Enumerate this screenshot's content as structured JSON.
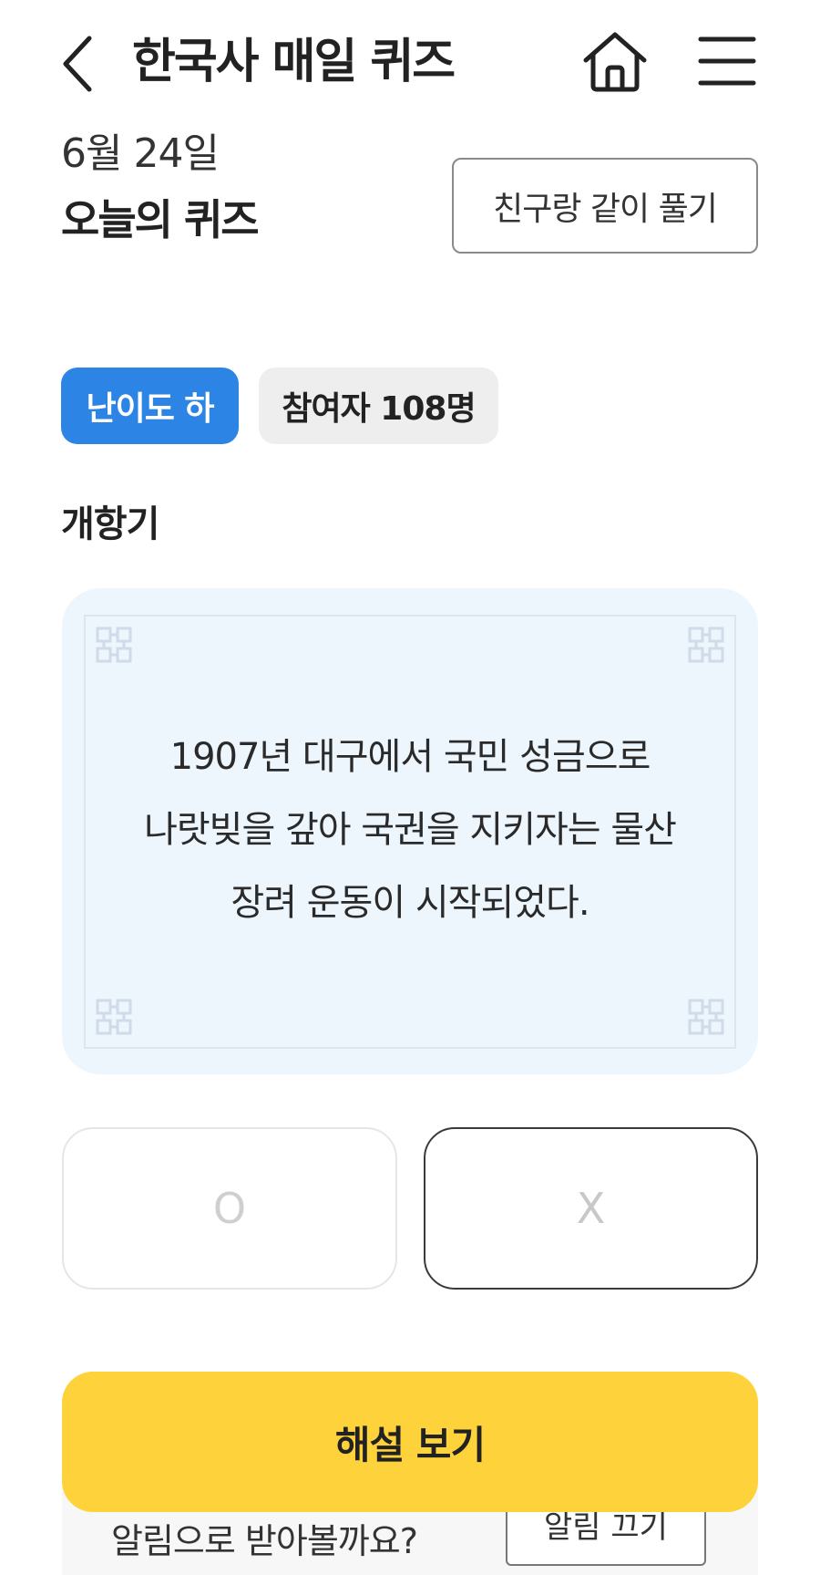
{
  "header": {
    "title": "한국사 매일 퀴즈",
    "back_icon": "chevron-left-icon",
    "home_icon": "home-icon",
    "menu_icon": "hamburger-menu-icon"
  },
  "quiz_info": {
    "date": "6월 24일",
    "heading": "오늘의 퀴즈",
    "friend_button": "친구랑 같이 풀기"
  },
  "badges": {
    "level": "난이도 하",
    "participants": "참여자 108명"
  },
  "category": "개항기",
  "question": {
    "lines": [
      "1907년 대구에서 국민 성금으로",
      "나랏빚을 갚아 국권을 지키자는 물산",
      "장려 운동이 시작되었다."
    ]
  },
  "answers": {
    "o_label": "O",
    "x_label": "X"
  },
  "explain_button": "해설 보기",
  "notice": {
    "text": "알림으로 받아볼까요?",
    "button": "알림 끄기"
  },
  "colors": {
    "accent_blue": "#2c84e5",
    "explain_yellow": "#fdd23b",
    "card_background": "#eef6fd"
  }
}
